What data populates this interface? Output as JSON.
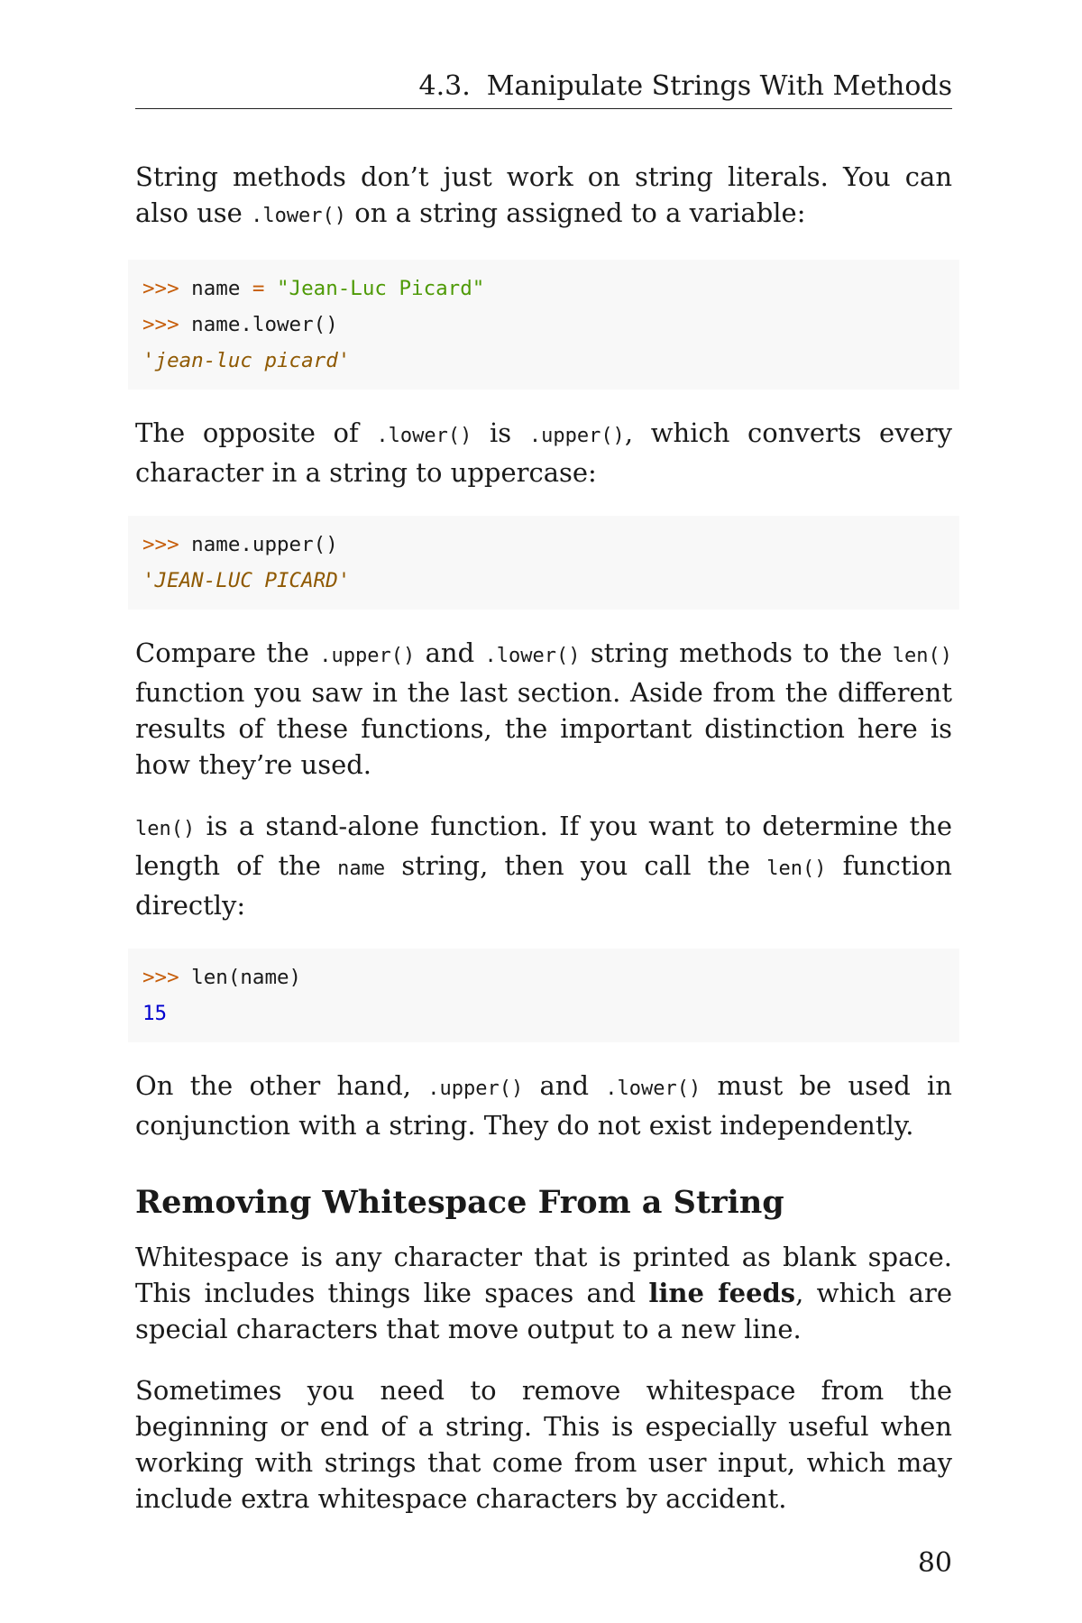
{
  "header": {
    "section_number": "4.3.",
    "section_title": "Manipulate Strings With Methods"
  },
  "para1": {
    "t1": "String methods don’t just work on string literals. You can also use ",
    "c1": ".lower()",
    "t2": " on a string assigned to a variable:"
  },
  "code1": {
    "l1_prompt": ">>>",
    "l1_a": " name ",
    "l1_op": "=",
    "l1_sp": " ",
    "l1_str": "\"Jean-Luc Picard\"",
    "l2_prompt": ">>>",
    "l2_a": " name.lower()",
    "l3_out": "'jean-luc picard'"
  },
  "para2": {
    "t1": "The opposite of ",
    "c1": ".lower()",
    "t2": " is ",
    "c2": ".upper()",
    "t3": ", which converts every character in a string to uppercase:"
  },
  "code2": {
    "l1_prompt": ">>>",
    "l1_a": " name.upper()",
    "l2_out": "'JEAN-LUC PICARD'"
  },
  "para3": {
    "t1": "Compare the ",
    "c1": ".upper()",
    "t2": " and ",
    "c2": ".lower()",
    "t3": " string methods to the ",
    "c3": "len()",
    "t4": " func­tion you saw in the last section. Aside from the different results of these functions, the important distinction here is how they’re used."
  },
  "para4": {
    "c1": "len()",
    "t1": " is a stand-alone function. If you want to determine the length of the ",
    "c2": "name",
    "t2": " string, then you call the ",
    "c3": "len()",
    "t3": " function directly:"
  },
  "code3": {
    "l1_prompt": ">>>",
    "l1_a": " len(name)",
    "l2_num": "15"
  },
  "para5": {
    "t1": "On the other hand, ",
    "c1": ".upper()",
    "t2": " and ",
    "c2": ".lower()",
    "t3": " must be used in conjunction with a string. They do not exist independently."
  },
  "heading": "Removing Whitespace From a String",
  "para6": {
    "t1": "Whitespace is any character that is printed as blank space. This in­cludes things like spaces and ",
    "b1": "line feeds",
    "t2": ", which are special characters that move output to a new line."
  },
  "para7": {
    "t1": "Sometimes you need to remove whitespace from the beginning or end of a string. This is especially useful when working with strings that come from user input, which may include extra whitespace characters by accident."
  },
  "page_number": "80"
}
